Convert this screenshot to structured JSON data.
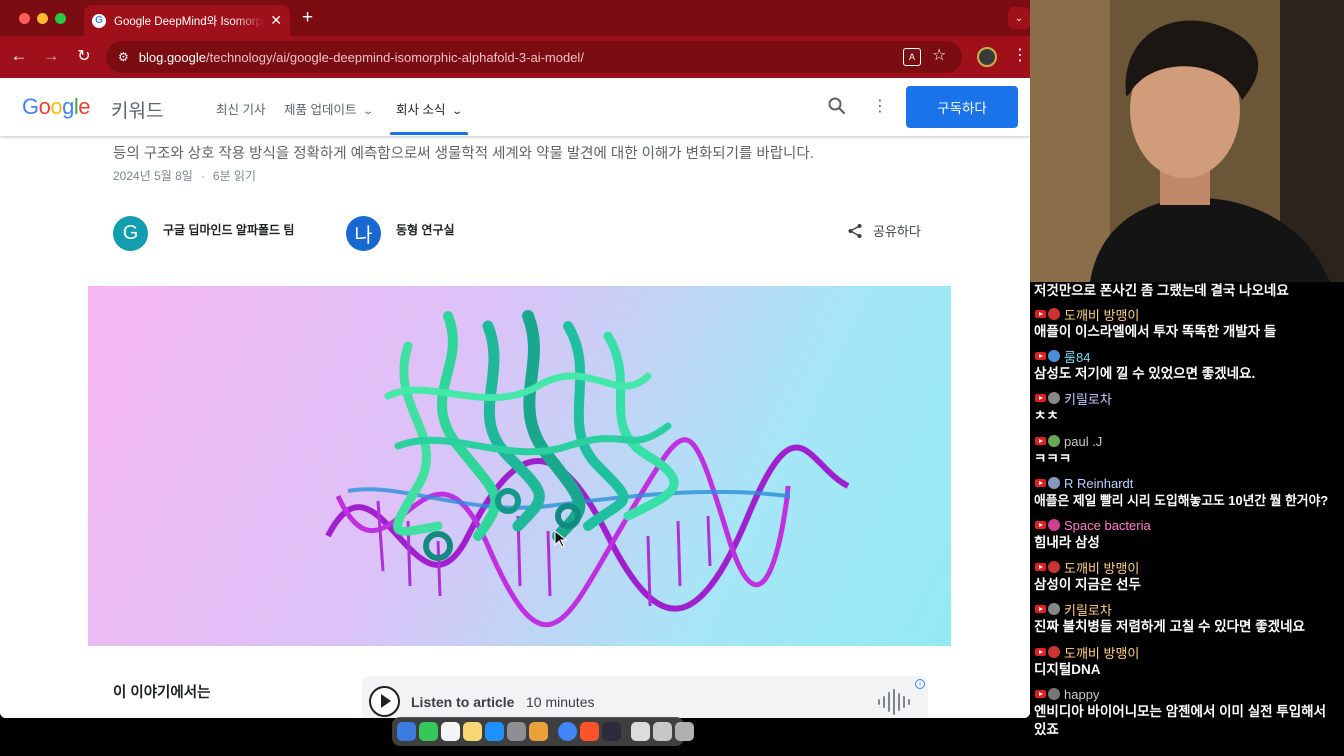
{
  "browser": {
    "tab_title": "Google DeepMind와 Isomorphic Labs",
    "url_domain": "blog.google",
    "url_path": "/technology/ai/google-deepmind-isomorphic-alphafold-3-ai-model/"
  },
  "site": {
    "logo": "Google",
    "name": "키워드",
    "nav": [
      {
        "label": "최신 기사"
      },
      {
        "label": "제품 업데이트"
      },
      {
        "label": "회사 소식"
      }
    ],
    "subscribe_label": "구독하다"
  },
  "article": {
    "summary": "등의 구조와 상호 작용 방식을 정확하게 예측함으로써 생물학적 세계와 약물 발견에 대한 이해가 변화되기를 바랍니다.",
    "date": "2024년 5월 8일",
    "read_time": "6분 읽기",
    "authors": [
      {
        "initial": "G",
        "name": "구글 딥마인드 알파폴드 팀"
      },
      {
        "initial": "나",
        "name": "동형 연구실"
      }
    ],
    "share_label": "공유하다",
    "toc_title": "이 이야기에서는",
    "audio": {
      "label": "Listen to article",
      "duration": "10 minutes"
    }
  },
  "chat": {
    "messages": [
      {
        "user": "",
        "text": "저것만으로 폰사긴 좀 그랬는데 결국 나오네요",
        "name_color": "#ffffff",
        "avatar_color": "#cc3333"
      },
      {
        "user": "도깨비 방맹이",
        "text": "애플이 이스라엘에서 투자 똑똑한 개발자 들",
        "name_color": "#ffd080",
        "avatar_color": "#cc3333"
      },
      {
        "user": "룸84",
        "text": "삼성도 저기에 낄 수 있었으면 좋겠네요.",
        "name_color": "#7ed7f0",
        "avatar_color": "#4a90d9"
      },
      {
        "user": "키릴로차",
        "text": "ㅊㅊ",
        "name_color": "#c8c8ff",
        "avatar_color": "#888888"
      },
      {
        "user": "paul .J",
        "text": "ㅋㅋㅋ",
        "name_color": "#c8c8c8",
        "avatar_color": "#6aa84f"
      },
      {
        "user": "R Reinhardt",
        "text": "애플은 제일 빨리 시리 도입해놓고도 10년간 뭘 한거야?",
        "name_color": "#b8d0ff",
        "avatar_color": "#8899bb"
      },
      {
        "user": "Space bacteria",
        "text": "힘내라 삼성",
        "name_color": "#ff80c8",
        "avatar_color": "#d04090"
      },
      {
        "user": "도깨비 방맹이",
        "text": "삼성이 지금은 선두",
        "name_color": "#ffd080",
        "avatar_color": "#cc3333"
      },
      {
        "user": "키릴로차",
        "text": "진짜 불치병들 저렴하게 고칠 수 있다면 좋겠네요",
        "name_color": "#ffd080",
        "avatar_color": "#888888"
      },
      {
        "user": "도깨비 방맹이",
        "text": "디지털DNA",
        "name_color": "#ffd080",
        "avatar_color": "#cc3333"
      },
      {
        "user": "happy",
        "text": "엔비디아 바이어니모는 암젠에서 이미 실전 투입해서 있죠",
        "name_color": "#c8c8c8",
        "avatar_color": "#777777"
      }
    ]
  },
  "colors": {
    "tab_bar": "#7a0c12",
    "toolbar": "#a0101a",
    "accent": "#1a73e8"
  },
  "icons": [
    "back-arrow-icon",
    "forward-arrow-icon",
    "reload-icon",
    "site-info-icon",
    "translate-icon",
    "star-icon",
    "kebab-icon",
    "search-icon",
    "more-vert-icon",
    "share-icon",
    "play-icon",
    "audio-wave-icon",
    "info-icon"
  ]
}
